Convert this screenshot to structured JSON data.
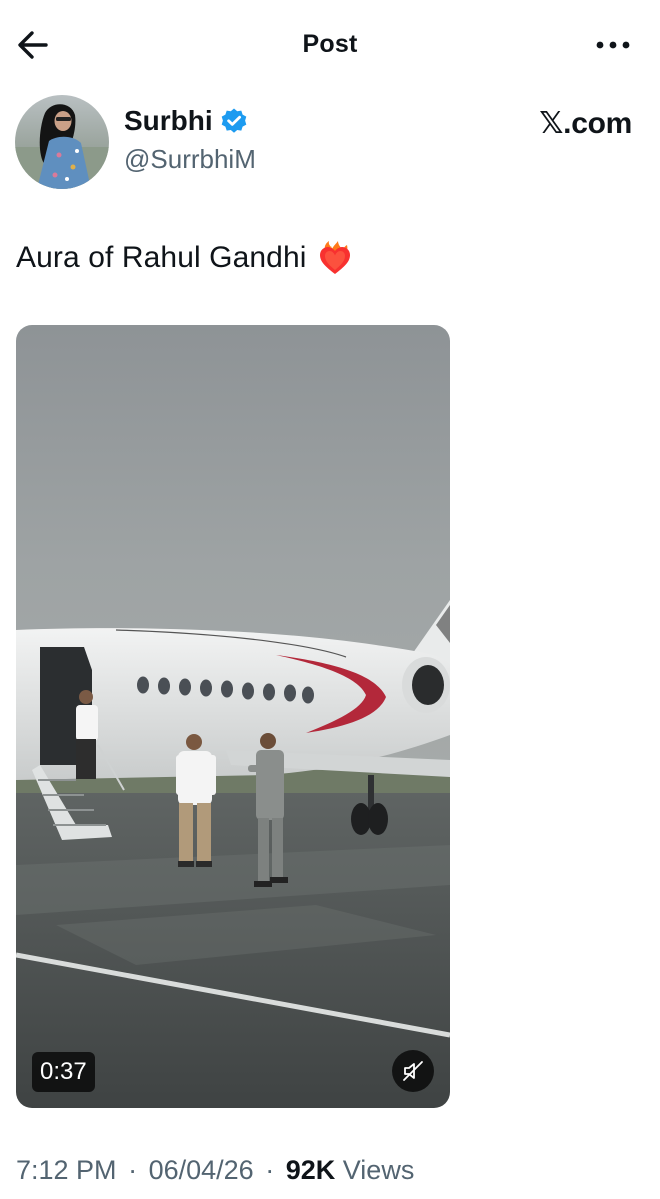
{
  "header": {
    "title": "Post",
    "back_icon": "arrow-left-icon",
    "more_icon": "more-horizontal-icon"
  },
  "author": {
    "name": "Surbhi",
    "handle": "@SurrbhiM",
    "verified": true,
    "verified_color": "#1d9bf0",
    "avatar": "profile photo of woman"
  },
  "source_watermark": {
    "x_glyph": "𝕏",
    "suffix": ".com"
  },
  "tweet": {
    "text": "Aura of Rahul Gandhi",
    "emoji": "heart-on-fire-icon"
  },
  "video": {
    "duration": "0:37",
    "muted": true,
    "mute_icon": "speaker-muted-icon",
    "scene": "men stepping off a private jet on a wet runway under grey sky"
  },
  "meta": {
    "time": "7:12 PM",
    "date": "06/04/26",
    "views_count": "92K",
    "views_label": "Views",
    "separator": "·"
  },
  "colors": {
    "text_primary": "#0f1419",
    "text_secondary": "#536471",
    "verified_blue": "#1d9bf0",
    "background": "#ffffff"
  }
}
